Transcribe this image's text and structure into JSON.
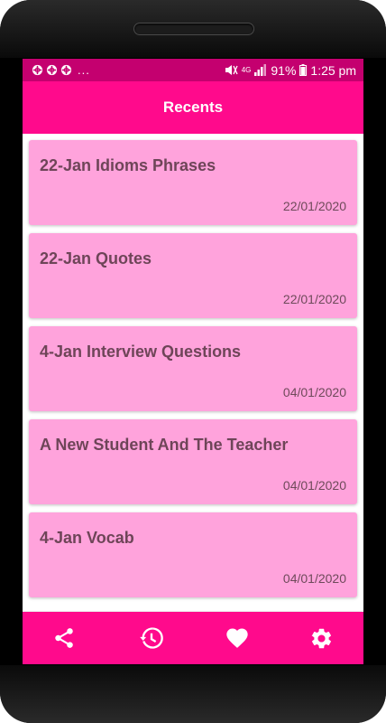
{
  "status_bar": {
    "notification_dots": "...",
    "battery_percent": "91%",
    "time": "1:25 pm",
    "network_label": "4G"
  },
  "app_bar": {
    "title": "Recents"
  },
  "recents": [
    {
      "title": "22-Jan Idioms Phrases",
      "date": "22/01/2020"
    },
    {
      "title": "22-Jan Quotes",
      "date": "22/01/2020"
    },
    {
      "title": "4-Jan Interview Questions",
      "date": "04/01/2020"
    },
    {
      "title": "A New Student And The Teacher",
      "date": "04/01/2020"
    },
    {
      "title": "4-Jan Vocab",
      "date": "04/01/2020"
    }
  ],
  "bottom_nav": {
    "items": [
      {
        "icon": "share-icon"
      },
      {
        "icon": "history-icon"
      },
      {
        "icon": "heart-icon"
      },
      {
        "icon": "settings-icon"
      }
    ]
  },
  "colors": {
    "status_bar": "#c4006f",
    "primary": "#ff0a8c",
    "card": "#ffa3dc",
    "card_text": "#6e4558"
  }
}
